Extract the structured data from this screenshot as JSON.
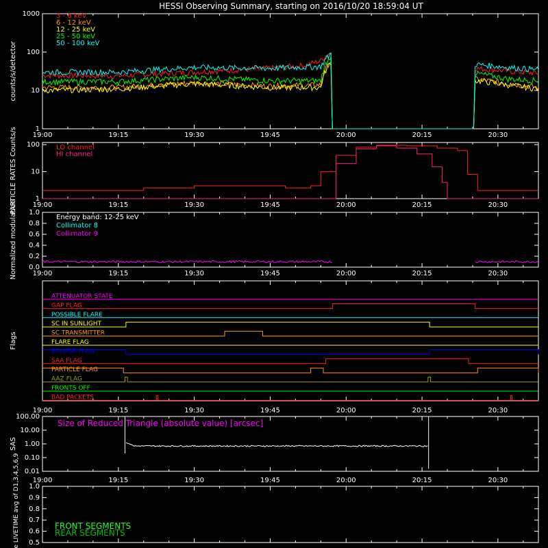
{
  "title": "HESSI Observing Summary, starting on 2016/10/20 18:59:04 UT",
  "time_ticks": [
    "19:00",
    "19:15",
    "19:30",
    "19:45",
    "20:00",
    "20:15",
    "20:30"
  ],
  "colors": {
    "fg": "#ffffff",
    "red": "#ff2020",
    "orange": "#ff9900",
    "yellow": "#ffff00",
    "green": "#00ff00",
    "cyan": "#00ffff",
    "magenta": "#ff00ff",
    "blue": "#0000ff",
    "olive": "#a0a000",
    "lightgreen": "#20ff20",
    "darkgreen": "#00c000"
  },
  "chart_data": [
    {
      "id": "count-rates",
      "type": "line",
      "ylabel": "counts/s/detector",
      "yscale": "log",
      "ylim": [
        1,
        1000
      ],
      "yticks": [
        "1",
        "10",
        "100",
        "1000"
      ],
      "xlim_min": [
        0,
        110
      ],
      "series": [
        {
          "name": "3 - 6 keV",
          "color": "#ff2020",
          "points": [
            [
              0,
              25
            ],
            [
              15,
              24
            ],
            [
              30,
              30
            ],
            [
              45,
              38
            ],
            [
              52,
              45
            ],
            [
              55,
              60
            ],
            [
              57,
              100
            ],
            [
              57.3,
              1
            ],
            [
              85.2,
              1
            ],
            [
              85.5,
              38
            ],
            [
              92,
              32
            ],
            [
              98,
              28
            ]
          ]
        },
        {
          "name": "6 - 12 keV",
          "color": "#ff9900",
          "points": [
            [
              0,
              12
            ],
            [
              15,
              12
            ],
            [
              30,
              16
            ],
            [
              45,
              13
            ],
            [
              55,
              14
            ],
            [
              57,
              60
            ],
            [
              57.3,
              1
            ],
            [
              85.2,
              1
            ],
            [
              85.5,
              20
            ],
            [
              92,
              15
            ],
            [
              98,
              12
            ]
          ]
        },
        {
          "name": "12 - 25 keV",
          "color": "#ffff00",
          "points": [
            [
              0,
              10
            ],
            [
              15,
              11
            ],
            [
              30,
              15
            ],
            [
              45,
              12
            ],
            [
              55,
              12
            ],
            [
              57,
              55
            ],
            [
              57.3,
              1
            ],
            [
              85.2,
              1
            ],
            [
              85.5,
              18
            ],
            [
              92,
              14
            ],
            [
              98,
              11
            ]
          ]
        },
        {
          "name": "25 - 50 keV",
          "color": "#00ff00",
          "points": [
            [
              0,
              17
            ],
            [
              15,
              17
            ],
            [
              30,
              22
            ],
            [
              45,
              18
            ],
            [
              55,
              18
            ],
            [
              57,
              80
            ],
            [
              57.3,
              1
            ],
            [
              85.2,
              1
            ],
            [
              85.5,
              28
            ],
            [
              92,
              20
            ],
            [
              98,
              18
            ]
          ]
        },
        {
          "name": "50 - 100 keV",
          "color": "#00ffff",
          "points": [
            [
              0,
              30
            ],
            [
              15,
              30
            ],
            [
              30,
              40
            ],
            [
              45,
              38
            ],
            [
              55,
              42
            ],
            [
              57,
              90
            ],
            [
              57.3,
              1
            ],
            [
              85.2,
              1
            ],
            [
              85.5,
              48
            ],
            [
              92,
              40
            ],
            [
              98,
              35
            ]
          ]
        }
      ]
    },
    {
      "id": "particle-rates",
      "type": "line",
      "ylabel": "PARTICLE RATES Counts/s",
      "yscale": "log",
      "ylim": [
        1,
        120
      ],
      "yticks": [
        "1",
        "10",
        "100"
      ],
      "series": [
        {
          "name": "LO channel",
          "color": "#ff2020",
          "points": [
            [
              0,
              2
            ],
            [
              10,
              2
            ],
            [
              20,
              2.5
            ],
            [
              30,
              3
            ],
            [
              40,
              3
            ],
            [
              48,
              2.5
            ],
            [
              53,
              3
            ],
            [
              55,
              10
            ],
            [
              58,
              40
            ],
            [
              62,
              80
            ],
            [
              66,
              95
            ],
            [
              72,
              90
            ],
            [
              78,
              75
            ],
            [
              82,
              60
            ],
            [
              84,
              8
            ],
            [
              86,
              2
            ],
            [
              98,
              2
            ]
          ]
        },
        {
          "name": "HI channel",
          "color": "#ff2080",
          "points": [
            [
              0,
              1
            ],
            [
              56,
              1
            ],
            [
              58,
              20
            ],
            [
              62,
              70
            ],
            [
              66,
              90
            ],
            [
              70,
              75
            ],
            [
              74,
              45
            ],
            [
              77,
              15
            ],
            [
              79,
              4
            ],
            [
              80,
              1
            ],
            [
              98,
              1
            ]
          ]
        }
      ]
    },
    {
      "id": "modulation",
      "type": "line",
      "ylabel": "Normalized modulation",
      "ylim": [
        0,
        1
      ],
      "yticks": [
        "0.0",
        "0.2",
        "0.4",
        "0.6",
        "0.8",
        "1.0"
      ],
      "annotation": "Energy band: 12-25 keV",
      "series": [
        {
          "name": "Collimator 8",
          "color": "#00ffff",
          "points": []
        },
        {
          "name": "Collimator 9",
          "color": "#ff00ff",
          "points": [
            [
              0,
              0.1
            ],
            [
              57.3,
              0.1
            ],
            [
              85.5,
              0.1
            ],
            [
              98,
              0.1
            ]
          ]
        }
      ]
    },
    {
      "id": "flags",
      "type": "step",
      "ylabel": "Flags",
      "rows": [
        {
          "name": "ATTENUATOR STATE",
          "color": "#ff00ff",
          "high": []
        },
        {
          "name": "GAP FLAG",
          "color": "#ff2020",
          "high": [
            [
              57.3,
              85.5
            ]
          ]
        },
        {
          "name": "POSSIBLE FLARE",
          "color": "#00ffff",
          "high": []
        },
        {
          "name": "SC IN SUNLIGHT",
          "color": "#ffff00",
          "high": [
            [
              16.5,
              76.5
            ]
          ]
        },
        {
          "name": "SC TRANSMITTER",
          "color": "#ff9900",
          "high": [
            [
              36,
              43.5
            ]
          ]
        },
        {
          "name": "FLARE FLAG",
          "color": "#ffff00",
          "high": []
        },
        {
          "name": "ECLIPSE FLAG",
          "color": "#0000ff",
          "high": [
            [
              0,
              16.5
            ],
            [
              76.5,
              98
            ]
          ]
        },
        {
          "name": "SAA FLAG",
          "color": "#ff2020",
          "high": [
            [
              56,
              84.2
            ]
          ]
        },
        {
          "name": "PARTICLE FLAG",
          "color": "#ff9900",
          "high": [
            [
              0,
              16
            ],
            [
              53,
              55.5
            ],
            [
              86,
              98
            ]
          ]
        },
        {
          "name": "AAZ FLAG",
          "color": "#a0a000",
          "high": [
            [
              16.3,
              16.8
            ],
            [
              76.2,
              76.7
            ]
          ]
        },
        {
          "name": "FRONTS OFF",
          "color": "#00ff00",
          "high": []
        },
        {
          "name": "BAD PACKETS",
          "color": "#ff2020",
          "high": [
            [
              22.5,
              22.8
            ],
            [
              92.5,
              92.8
            ]
          ]
        }
      ]
    },
    {
      "id": "sas",
      "type": "line",
      "ylabel": "SAS",
      "yscale": "log",
      "ylim": [
        0.01,
        100
      ],
      "yticks": [
        "0.01",
        "0.10",
        "1.00",
        "10.00",
        "100.00"
      ],
      "annotation": "Size of Reduced Triangle (absolute value) [arcsec]",
      "series": [
        {
          "name": "",
          "color": "#ffffff",
          "points": [
            [
              16.3,
              0.5
            ],
            [
              16.5,
              50
            ],
            [
              17,
              0.8
            ],
            [
              25,
              0.7
            ],
            [
              50,
              0.65
            ],
            [
              75,
              0.6
            ],
            [
              76.3,
              40
            ]
          ]
        }
      ]
    },
    {
      "id": "livetime",
      "type": "line",
      "ylabel": "Mon. Rate LIVETIME avg of D1,3,4,5,6,9",
      "ylim": [
        0.5,
        1.0
      ],
      "yticks": [
        "0.5",
        "0.6",
        "0.7",
        "0.8",
        "0.9",
        "1.0"
      ],
      "series": [
        {
          "name": "FRONT SEGMENTS",
          "color": "#20ff20",
          "points": []
        },
        {
          "name": "REAR SEGMENTS",
          "color": "#00c000",
          "points": []
        }
      ]
    }
  ]
}
